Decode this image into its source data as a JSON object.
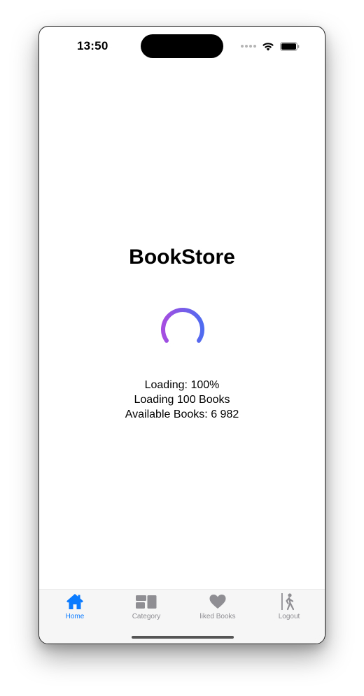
{
  "status_bar": {
    "time": "13:50",
    "icons": [
      "signal-dots-icon",
      "wifi-icon",
      "battery-icon"
    ]
  },
  "main": {
    "title": "BookStore",
    "spinner_icon": "loading-spinner-icon",
    "loading_percent_text": "Loading: 100%",
    "loading_books_text": "Loading 100 Books",
    "available_books_text": "Available Books: 6 982"
  },
  "tab_bar": {
    "tabs": [
      {
        "label": "Home",
        "icon": "house-icon",
        "active": true
      },
      {
        "label": "Category",
        "icon": "category-icon",
        "active": false
      },
      {
        "label": "liked Books",
        "icon": "heart-icon",
        "active": false
      },
      {
        "label": "Logout",
        "icon": "logout-icon",
        "active": false
      }
    ]
  },
  "colors": {
    "accent": "#0a7aff",
    "tab_inactive": "#8e8e93",
    "spinner_gradient_start": "#a54de0",
    "spinner_gradient_end": "#4f6bf0"
  }
}
